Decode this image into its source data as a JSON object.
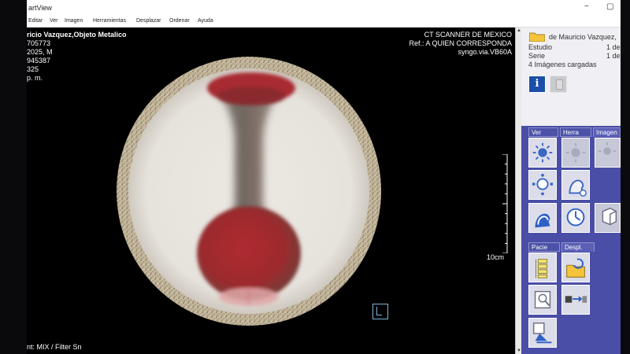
{
  "window": {
    "title": "artView",
    "minimize": "−",
    "maximize": "▢"
  },
  "menu": [
    "Editar",
    "Ver",
    "Imagen",
    "Herramientas",
    "Desplazar",
    "Ordenar",
    "Ayuda"
  ],
  "overlay": {
    "top_left": [
      "ricio Vazquez,Objeto Metalico",
      "705773",
      "2025, M",
      "945387",
      "325",
      "p. m."
    ],
    "top_right": [
      "CT SCANNER DE MEXICO",
      "Ref.: A QUIEN  CORRESPONDA",
      "syngo.via.VB60A"
    ],
    "bottom_left": "nt: MIX / Filter Sn",
    "scale_label": "10cm"
  },
  "panel": {
    "patient": "de Mauricio Vazquez,",
    "study_label": "Estudio",
    "study_value": "1 de",
    "series_label": "Serie",
    "series_value": "1 de",
    "loaded": "4 Imágenes cargadas",
    "info_glyph": "i",
    "tabs_top": [
      "Ver",
      "Herra",
      "Imagen"
    ],
    "tabs_bottom": [
      "Pacie",
      "Despl."
    ],
    "tool_icons": [
      "brightness-icon",
      "brightness-dim-icon",
      "brightness-2-icon",
      "head-rotate-icon",
      "head-profile-icon",
      "head-rotate-alt-icon",
      "head-clock-icon",
      "head-refresh-icon",
      "cube-rotate-icon"
    ],
    "patient_icons": [
      "patient-list-icon",
      "folder-refresh-icon",
      "patient-browser-icon",
      "export-icon",
      "film-export-icon"
    ]
  },
  "colors": {
    "panel": "#4a4ea6",
    "scan_background": "#ece8e2",
    "contrast": "#a8262c"
  }
}
